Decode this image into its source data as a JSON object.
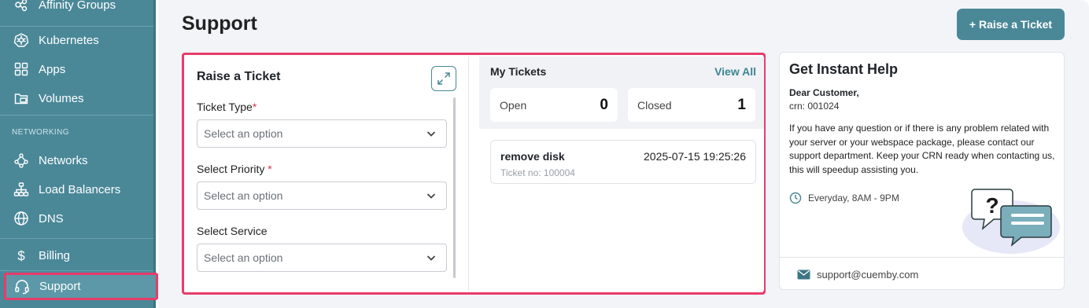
{
  "sidebar": {
    "items": [
      {
        "label": "Affinity Groups",
        "icon": "affinity-groups-icon"
      },
      {
        "label": "Kubernetes",
        "icon": "kubernetes-icon"
      },
      {
        "label": "Apps",
        "icon": "apps-grid-icon"
      },
      {
        "label": "Volumes",
        "icon": "volumes-icon"
      },
      {
        "label": "Networks",
        "icon": "networks-icon"
      },
      {
        "label": "Load Balancers",
        "icon": "load-balancers-icon"
      },
      {
        "label": "DNS",
        "icon": "globe-icon"
      },
      {
        "label": "Billing",
        "icon": "dollar-icon"
      },
      {
        "label": "Support",
        "icon": "headset-icon"
      }
    ],
    "section_networking": "NETWORKING",
    "active_item": "Support"
  },
  "header": {
    "title": "Support",
    "raise_button": "+ Raise a Ticket"
  },
  "form": {
    "title": "Raise a Ticket",
    "fields": [
      {
        "label": "Ticket Type",
        "required": "*",
        "placeholder": "Select an option"
      },
      {
        "label": "Select Priority",
        "required": "*",
        "placeholder": "Select an option"
      },
      {
        "label": "Select Service",
        "required": "",
        "placeholder": "Select an option"
      }
    ]
  },
  "tickets": {
    "title": "My Tickets",
    "view_all": "View All",
    "open_label": "Open",
    "open_count": "0",
    "closed_label": "Closed",
    "closed_count": "1",
    "list": [
      {
        "name": "remove disk",
        "date": "2025-07-15 19:25:26",
        "number": "Ticket no: 100004"
      }
    ]
  },
  "help": {
    "title": "Get Instant Help",
    "greeting": "Dear Customer,",
    "crn": "crn: 001024",
    "body": "If you have any question or if there is any problem related with your server or your webspace package, please contact our support department. Keep your CRN ready when contacting us, this will speedup assisting you.",
    "hours": "Everyday, 8AM - 9PM",
    "email": "support@cuemby.com"
  },
  "colors": {
    "sidebar": "#4a8898",
    "accent": "#4a8898",
    "highlight": "#e83c6a",
    "link": "#3d8494"
  }
}
